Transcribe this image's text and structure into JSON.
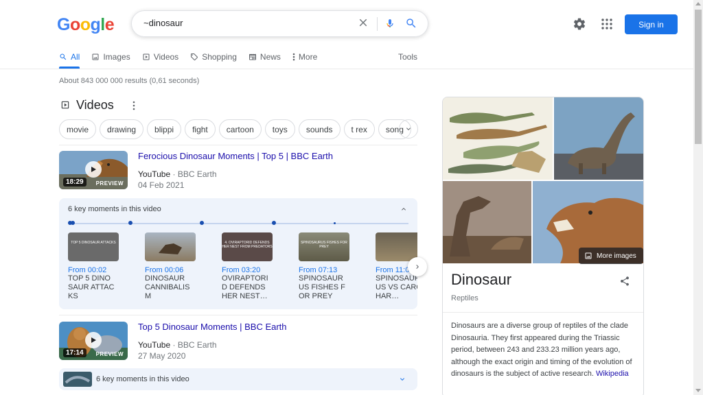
{
  "logo": {
    "letters": [
      "G",
      "o",
      "o",
      "g",
      "l",
      "e"
    ],
    "colors": [
      "#4285f4",
      "#ea4335",
      "#fbbc05",
      "#4285f4",
      "#34a853",
      "#ea4335"
    ]
  },
  "search": {
    "query": "~dinosaur"
  },
  "header": {
    "signin_label": "Sign in"
  },
  "tabs": {
    "items": [
      {
        "label": "All",
        "icon": "search-icon"
      },
      {
        "label": "Images",
        "icon": "image-icon"
      },
      {
        "label": "Videos",
        "icon": "video-icon"
      },
      {
        "label": "Shopping",
        "icon": "tag-icon"
      },
      {
        "label": "News",
        "icon": "newspaper-icon"
      },
      {
        "label": "More",
        "icon": "more-vert-icon"
      }
    ],
    "tools_label": "Tools"
  },
  "stats": "About 843 000 000 results (0,61 seconds)",
  "videos": {
    "heading": "Videos",
    "chips": [
      "movie",
      "drawing",
      "blippi",
      "fight",
      "cartoon",
      "toys",
      "sounds",
      "t rex",
      "song"
    ],
    "results": [
      {
        "title": "Ferocious Dinosaur Moments | Top 5 | BBC Earth",
        "platform": "YouTube",
        "channel": "BBC Earth",
        "date": "04 Feb 2021",
        "duration": "18:29",
        "preview": "PREVIEW"
      },
      {
        "title": "Top 5 Dinosaur Moments | BBC Earth",
        "platform": "YouTube",
        "channel": "BBC Earth",
        "date": "27 May 2020",
        "duration": "17:14",
        "preview": "PREVIEW"
      }
    ],
    "key_moments": {
      "title": "6 key moments in this video",
      "items": [
        {
          "time": "From 00:02",
          "text": "TOP 5 DINOSAUR ATTACKS",
          "caption": "TOP 5 DINOSAUR ATTACKS"
        },
        {
          "time": "From 00:06",
          "text": "DINOSAUR CANNIBALISM",
          "caption": ""
        },
        {
          "time": "From 03:20",
          "text": "OVIRAPTORID DEFENDS HER NEST…",
          "caption": "4. OVIRAPTORID DEFENDS HER NEST FROM PREDATORS"
        },
        {
          "time": "From 07:13",
          "text": "SPINOSAURUS FISHES FOR PREY",
          "caption": "SPINOSAURUS FISHES FOR PREY"
        },
        {
          "time": "From 11:0",
          "text": "SPINOSAURUS VS CARCHAR…",
          "caption": ""
        }
      ]
    },
    "key_moments_2": {
      "title": "6 key moments in this video"
    }
  },
  "knowledge_panel": {
    "title": "Dinosaur",
    "subtitle": "Reptiles",
    "more_images_label": "More images",
    "description": "Dinosaurs are a diverse group of reptiles of the clade Dinosauria. They first appeared during the Triassic period, between 243 and 233.23 million years ago, although the exact origin and timing of the evolution of dinosaurs is the subject of active research.",
    "source_link": "Wikipedia"
  },
  "colors": {
    "accent": "#1a73e8",
    "link": "#1a0dab",
    "moments_bg": "#eef3fb"
  }
}
